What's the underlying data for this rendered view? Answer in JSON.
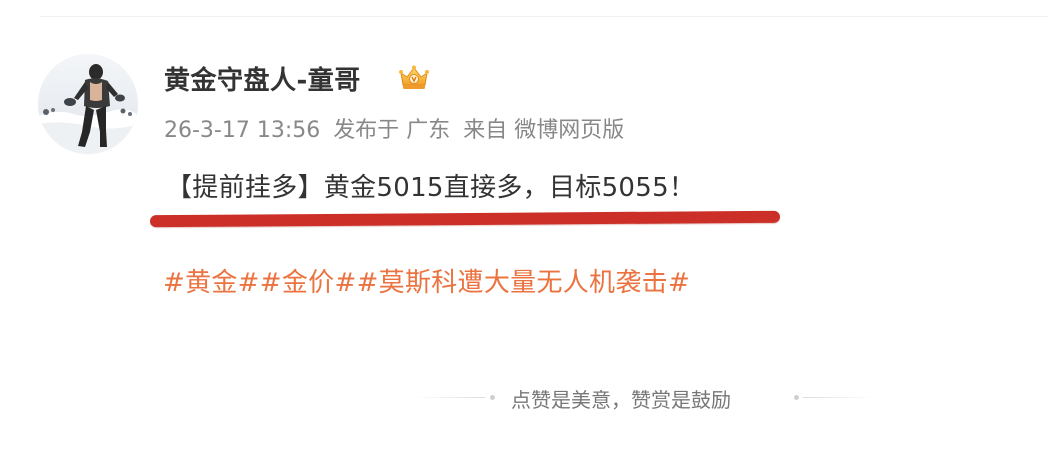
{
  "post": {
    "author": {
      "name": "黄金守盘人-童哥",
      "badge_icon": "vip-crown-icon",
      "avatar_icon": "avatar-photo"
    },
    "meta": {
      "timestamp": "26-3-17 13:56",
      "location": "发布于 广东",
      "source": "来自 微博网页版"
    },
    "text": "【提前挂多】黄金5015直接多，目标5055！",
    "hashtags": [
      "#黄金#",
      "#金价#",
      "#莫斯科遭大量无人机袭击#"
    ],
    "reward_prompt": "点赞是美意，赞赏是鼓励"
  },
  "colors": {
    "hashtag": "#eb7340",
    "underline": "#cc2f27",
    "text": "#333333",
    "meta": "#888888"
  }
}
